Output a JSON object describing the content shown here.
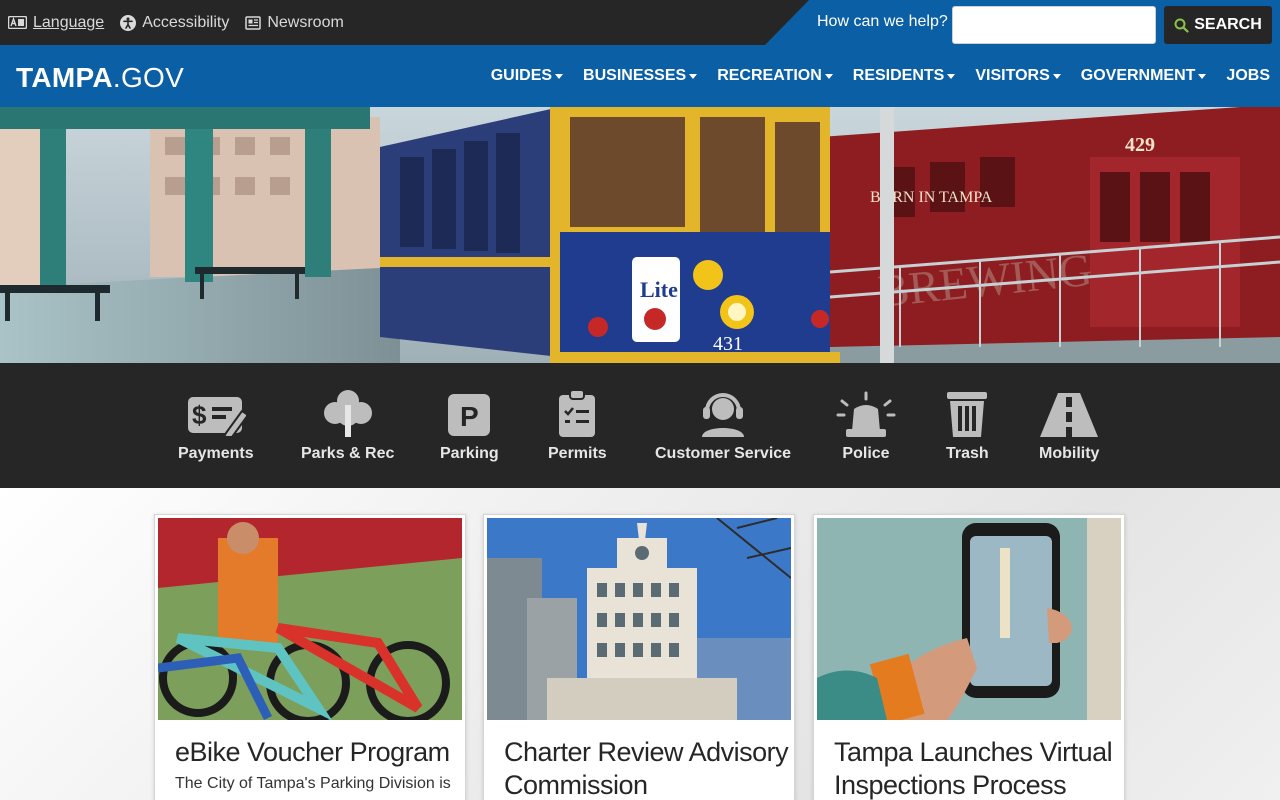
{
  "utility": {
    "language": "Language",
    "accessibility": "Accessibility",
    "newsroom": "Newsroom",
    "search_label": "How can we help?",
    "search_placeholder": "",
    "search_button": "SEARCH"
  },
  "brand": {
    "logo_main": "TAMPA",
    "logo_suffix": ".GOV"
  },
  "nav": {
    "items": [
      {
        "label": "GUIDES",
        "dropdown": true
      },
      {
        "label": "BUSINESSES",
        "dropdown": true
      },
      {
        "label": "RECREATION",
        "dropdown": true
      },
      {
        "label": "RESIDENTS",
        "dropdown": true
      },
      {
        "label": "VISITORS",
        "dropdown": true
      },
      {
        "label": "GOVERNMENT",
        "dropdown": true
      },
      {
        "label": "JOBS",
        "dropdown": false
      }
    ]
  },
  "hero": {
    "trolley_number_front": "431",
    "trolley_number_rear": "429",
    "trolley_sign": "BORN IN TAMPA",
    "ad_text": "Lite",
    "wall_text": "BREWING"
  },
  "quick_links": [
    {
      "label": "Payments",
      "icon": "payments-icon"
    },
    {
      "label": "Parks & Rec",
      "icon": "tree-icon"
    },
    {
      "label": "Parking",
      "icon": "parking-icon"
    },
    {
      "label": "Permits",
      "icon": "clipboard-icon"
    },
    {
      "label": "Customer Service",
      "icon": "headset-icon"
    },
    {
      "label": "Police",
      "icon": "siren-icon"
    },
    {
      "label": "Trash",
      "icon": "trash-icon"
    },
    {
      "label": "Mobility",
      "icon": "road-icon"
    }
  ],
  "news": [
    {
      "title": "eBike Voucher Program",
      "desc": "The City of Tampa's Parking Division is"
    },
    {
      "title": "Charter Review Advisory Commission",
      "desc": ""
    },
    {
      "title": "Tampa Launches Virtual Inspections Process",
      "desc": ""
    }
  ],
  "colors": {
    "brand_blue": "#0b5fa5",
    "dark_bar": "#262626",
    "search_icon_green": "#8bc34a",
    "icon_gray": "#bdbdbd"
  }
}
